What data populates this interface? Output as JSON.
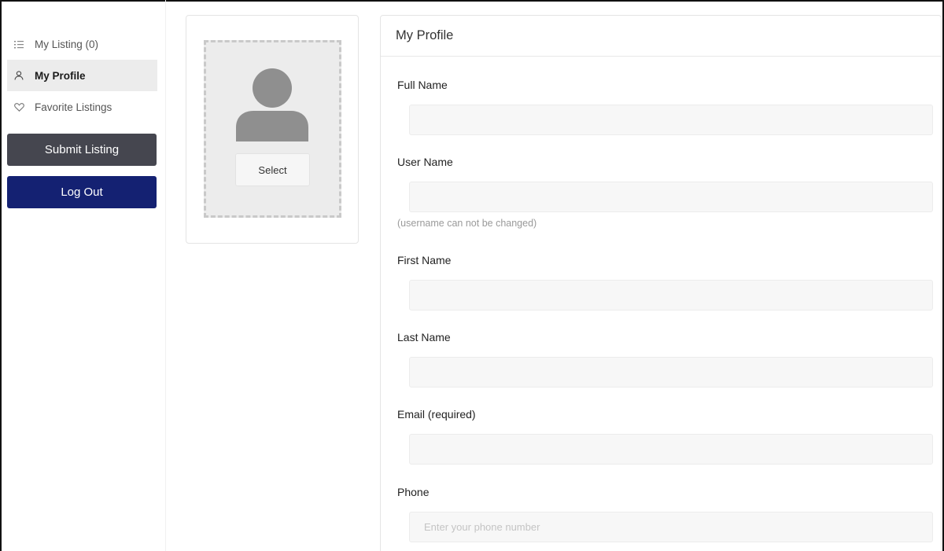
{
  "sidebar": {
    "items": [
      {
        "label": "My Listing (0)",
        "icon": "list-icon"
      },
      {
        "label": "My Profile",
        "icon": "user-icon"
      },
      {
        "label": "Favorite Listings",
        "icon": "heart-icon"
      }
    ],
    "submit_label": "Submit Listing",
    "logout_label": "Log Out"
  },
  "avatar": {
    "select_label": "Select"
  },
  "profile": {
    "title": "My Profile",
    "full_name_label": "Full Name",
    "full_name_value": "",
    "user_name_label": "User Name",
    "user_name_value": "",
    "user_name_hint": "(username can not be changed)",
    "first_name_label": "First Name",
    "first_name_value": "",
    "last_name_label": "Last Name",
    "last_name_value": "",
    "email_label": "Email (required)",
    "email_value": "",
    "phone_label": "Phone",
    "phone_value": "",
    "phone_placeholder": "Enter your phone number"
  },
  "colors": {
    "submit_button": "#45464f",
    "logout_button": "#142172",
    "active_item_bg": "#ececec"
  }
}
